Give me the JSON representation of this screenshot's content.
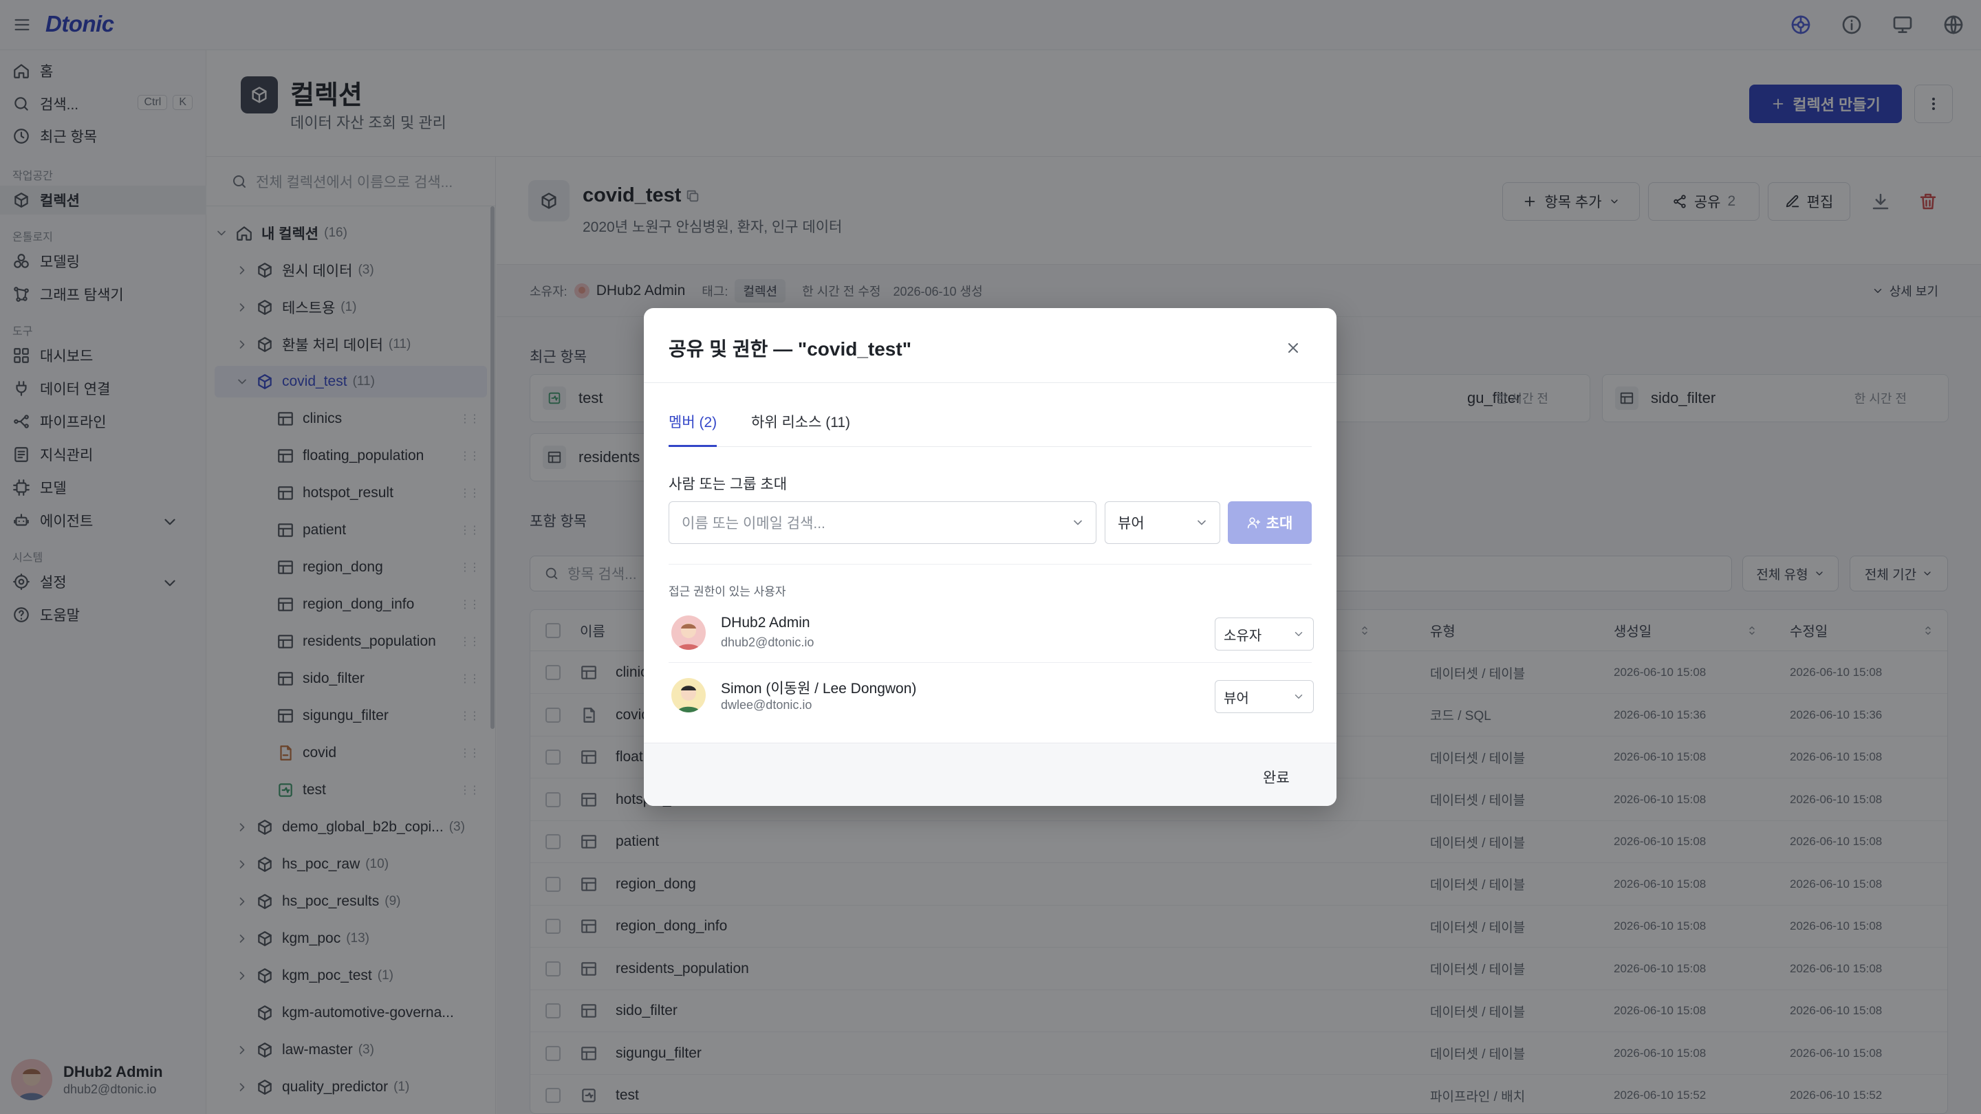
{
  "app": {
    "logo": "Dtonic"
  },
  "sidebar": {
    "home": "홈",
    "search": "검색...",
    "shortcut": [
      "Ctrl",
      "K"
    ],
    "recent": "최근 항목",
    "sections": {
      "workspace": "작업공간",
      "ontology": "온톨로지",
      "tools": "도구",
      "system": "시스템"
    },
    "collection": "컬렉션",
    "modeling": "모델링",
    "graph": "그래프 탐색기",
    "dashboard": "대시보드",
    "data_connect": "데이터 연결",
    "pipeline": "파이프라인",
    "knowledge": "지식관리",
    "model": "모델",
    "agent": "에이전트",
    "settings": "설정",
    "help": "도움말",
    "user": {
      "name": "DHub2 Admin",
      "email": "dhub2@dtonic.io"
    }
  },
  "header": {
    "title": "컬렉션",
    "subtitle": "데이터 자산 조회 및 관리",
    "create_button": "컬렉션 만들기"
  },
  "tree": {
    "search_placeholder": "전체 컬렉션에서 이름으로 검색...",
    "root": {
      "label": "내 컬렉션",
      "count": "(16)"
    },
    "items": [
      {
        "label": "원시 데이터",
        "count": "(3)"
      },
      {
        "label": "테스트용",
        "count": "(1)"
      },
      {
        "label": "환불 처리 데이터",
        "count": "(11)"
      },
      {
        "label": "covid_test",
        "count": "(11)"
      },
      {
        "label": "clinics"
      },
      {
        "label": "floating_population"
      },
      {
        "label": "hotspot_result"
      },
      {
        "label": "patient"
      },
      {
        "label": "region_dong"
      },
      {
        "label": "region_dong_info"
      },
      {
        "label": "residents_population"
      },
      {
        "label": "sido_filter"
      },
      {
        "label": "sigungu_filter"
      },
      {
        "label": "covid"
      },
      {
        "label": "test"
      },
      {
        "label": "demo_global_b2b_copi...",
        "count": "(3)"
      },
      {
        "label": "hs_poc_raw",
        "count": "(10)"
      },
      {
        "label": "hs_poc_results",
        "count": "(9)"
      },
      {
        "label": "kgm_poc",
        "count": "(13)"
      },
      {
        "label": "kgm_poc_test",
        "count": "(1)"
      },
      {
        "label": "kgm-automotive-governa..."
      },
      {
        "label": "law-master",
        "count": "(3)"
      },
      {
        "label": "quality_predictor",
        "count": "(1)"
      }
    ]
  },
  "detail": {
    "title": "covid_test",
    "subtitle": "2020년 노원구 안심병원, 환자, 인구 데이터",
    "add_item": "항목 추가",
    "share": "공유",
    "share_count": "2",
    "edit": "편집",
    "meta": {
      "owner_label": "소유자:",
      "owner": "DHub2 Admin",
      "tag_label": "태그:",
      "tag": "컬렉션",
      "modified": "한 시간 전 수정",
      "created": "2026-06-10 생성",
      "more": "상세 보기"
    },
    "recent_label": "최근 항목",
    "recent": [
      {
        "name": "test",
        "ago": ""
      },
      {
        "name": "gu_filter",
        "ago": "한 시간 전"
      },
      {
        "name": "sido_filter",
        "ago": "한 시간 전"
      },
      {
        "name": "residents",
        "ago": ""
      }
    ],
    "items_label": "포함 항목",
    "items_search": "항목 검색...",
    "filter_type": "전체 유형",
    "filter_period": "전체 기간",
    "columns": {
      "name": "이름",
      "type": "유형",
      "created": "생성일",
      "modified": "수정일"
    },
    "rows": [
      {
        "name": "clinics",
        "type": "데이터셋 / 테이블",
        "created": "2026-06-10 15:08",
        "modified": "2026-06-10 15:08"
      },
      {
        "name": "covid",
        "type": "코드 / SQL",
        "created": "2026-06-10 15:36",
        "modified": "2026-06-10 15:36"
      },
      {
        "name": "floating_population",
        "type": "데이터셋 / 테이블",
        "created": "2026-06-10 15:08",
        "modified": "2026-06-10 15:08"
      },
      {
        "name": "hotspot_result",
        "type": "데이터셋 / 테이블",
        "created": "2026-06-10 15:08",
        "modified": "2026-06-10 15:08"
      },
      {
        "name": "patient",
        "type": "데이터셋 / 테이블",
        "created": "2026-06-10 15:08",
        "modified": "2026-06-10 15:08"
      },
      {
        "name": "region_dong",
        "type": "데이터셋 / 테이블",
        "created": "2026-06-10 15:08",
        "modified": "2026-06-10 15:08"
      },
      {
        "name": "region_dong_info",
        "type": "데이터셋 / 테이블",
        "created": "2026-06-10 15:08",
        "modified": "2026-06-10 15:08"
      },
      {
        "name": "residents_population",
        "type": "데이터셋 / 테이블",
        "created": "2026-06-10 15:08",
        "modified": "2026-06-10 15:08"
      },
      {
        "name": "sido_filter",
        "type": "데이터셋 / 테이블",
        "created": "2026-06-10 15:08",
        "modified": "2026-06-10 15:08"
      },
      {
        "name": "sigungu_filter",
        "type": "데이터셋 / 테이블",
        "created": "2026-06-10 15:08",
        "modified": "2026-06-10 15:08"
      },
      {
        "name": "test",
        "type": "파이프라인 / 배치",
        "created": "2026-06-10 15:52",
        "modified": "2026-06-10 15:52"
      }
    ]
  },
  "modal": {
    "title": "공유 및 권한 — \"covid_test\"",
    "tabs": [
      "멤버 (2)",
      "하위 리소스 (11)"
    ],
    "invite_label": "사람 또는 그룹 초대",
    "invite_placeholder": "이름 또는 이메일 검색...",
    "invite_role": "뷰어",
    "invite_button": "초대",
    "access_label": "접근 권한이 있는 사용자",
    "users": [
      {
        "name": "DHub2 Admin",
        "email": "dhub2@dtonic.io",
        "role": "소유자"
      },
      {
        "name": "Simon (이동원 / Lee Dongwon)",
        "email": "dwlee@dtonic.io",
        "role": "뷰어"
      }
    ],
    "done": "완료"
  },
  "colors": {
    "accent": "#2b3fbf",
    "accent_light": "#a4ade9",
    "overlay": "rgba(20,22,26,0.5)"
  }
}
